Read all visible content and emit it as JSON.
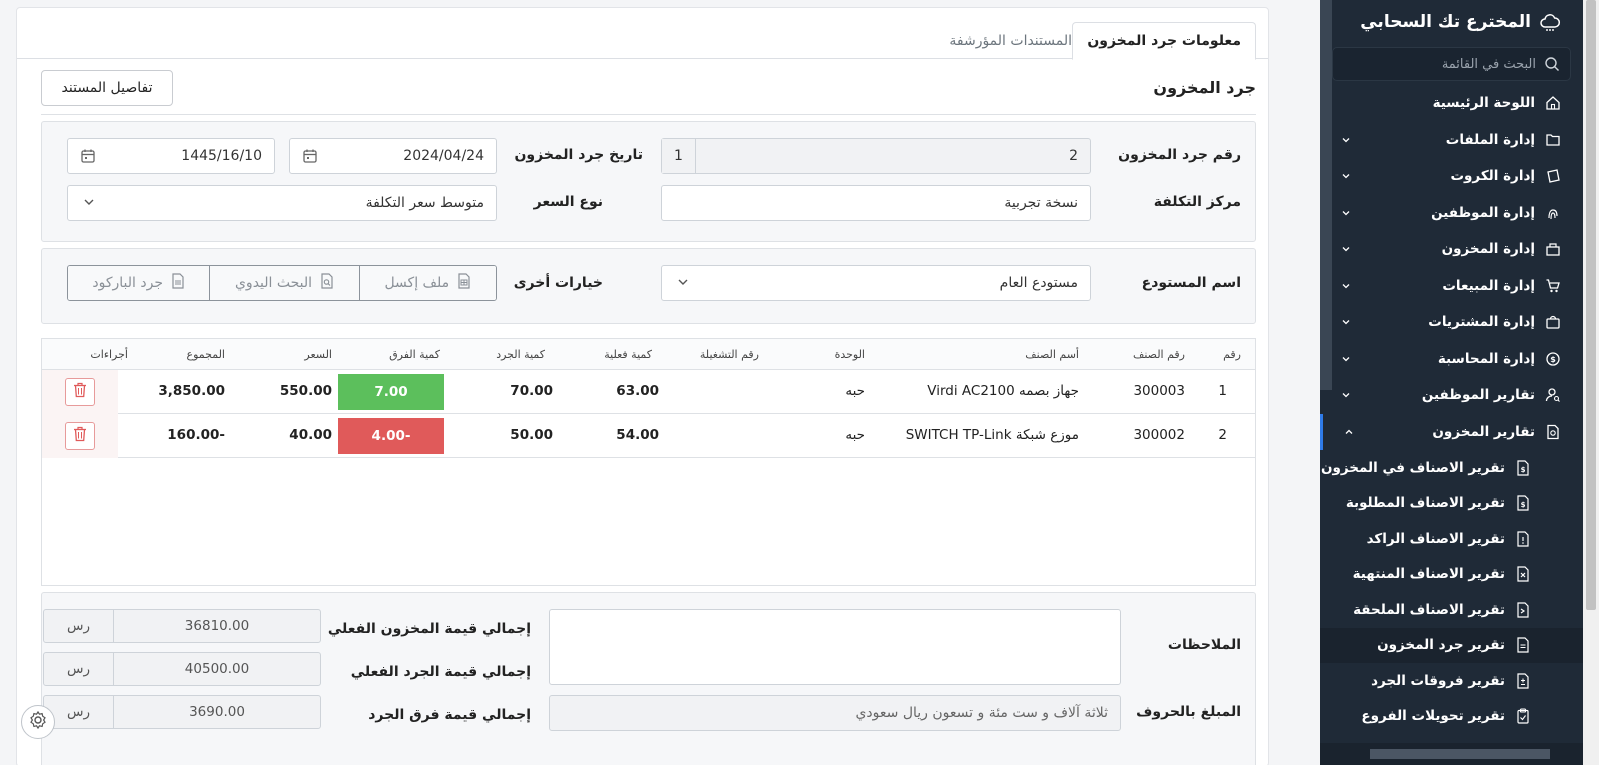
{
  "sidebar": {
    "brand": "المخترع تك السحابي",
    "search_placeholder": "البحث في القائمة",
    "items": [
      {
        "label": "اللوحة الرئيسية",
        "icon": "home-icon"
      },
      {
        "label": "إدارة الملفات",
        "icon": "folder-icon"
      },
      {
        "label": "إدارة الكروت",
        "icon": "card-icon"
      },
      {
        "label": "إدارة الموظفين",
        "icon": "fingerprint-icon"
      },
      {
        "label": "إدارة المخزون",
        "icon": "box-icon"
      },
      {
        "label": "إدارة المبيعات",
        "icon": "cart-icon"
      },
      {
        "label": "إدارة المشتريات",
        "icon": "bag-icon"
      },
      {
        "label": "إدارة المحاسبة",
        "icon": "coin-icon"
      },
      {
        "label": "تقارير الموظفين",
        "icon": "user-search-icon"
      },
      {
        "label": "تقارير المخزون",
        "icon": "report-icon"
      }
    ],
    "sub_items": [
      {
        "label": "تقرير الاصناف في المخزون"
      },
      {
        "label": "تقرير الاصناف المطلوبة"
      },
      {
        "label": "تقرير الاصناف الراكد"
      },
      {
        "label": "تقرير الاصناف المنتهية"
      },
      {
        "label": "تقرير الاصناف الملحقة"
      },
      {
        "label": "تقرير جرد المخزون"
      },
      {
        "label": "تقرير فروقات الجرد"
      },
      {
        "label": "تقرير تحويلات الفروع"
      }
    ]
  },
  "tabs": {
    "active": "معلومات جرد المخزون",
    "archived": "المستندات المؤرشفة"
  },
  "page_title": "جرد المخزون",
  "doc_details_button": "تفاصيل المستند",
  "form": {
    "inventory_number_label": "رقم جرد المخزون",
    "inventory_number": "2",
    "inventory_number_prefix": "1",
    "date_label": "تاريخ جرد المخزون",
    "date_gregorian": "2024/04/24",
    "date_hijri": "1445/16/10",
    "cost_center_label": "مركز التكلفة",
    "cost_center": "نسخة تجربية",
    "price_type_label": "نوع السعر",
    "price_type": "متوسط سعر التكلفة"
  },
  "warehouse": {
    "label": "اسم المستودع",
    "value": "مستودع العام",
    "other_options_label": "خيارات أخرى",
    "excel_button": "ملف إكسل",
    "manual_search_button": "البحث اليدوي",
    "barcode_button": "جرد الباركود"
  },
  "table": {
    "headers": {
      "num": "رقم",
      "item_code": "رقم الصنف",
      "item_name": "أسم الصنف",
      "unit": "الوحدة",
      "batch": "رقم التشغيلة",
      "actual_qty": "كمية فعلية",
      "count_qty": "كمية الجرد",
      "diff_qty": "كمية الفرق",
      "price": "السعر",
      "total": "المجموع",
      "actions": "أجراءات"
    },
    "rows": [
      {
        "num": "1",
        "item_code": "300003",
        "item_name": "جهاز بصمه Virdi AC2100",
        "unit": "حبه",
        "batch": "",
        "actual_qty": "63.00",
        "count_qty": "70.00",
        "diff_qty": "7.00",
        "price": "550.00",
        "total": "3,850.00",
        "diff_color": "#5cbf5c"
      },
      {
        "num": "2",
        "item_code": "300002",
        "item_name": "موزع شبكة SWITCH TP-Link",
        "unit": "حبه",
        "batch": "",
        "actual_qty": "54.00",
        "count_qty": "50.00",
        "diff_qty": "-4.00",
        "price": "40.00",
        "total": "-160.00",
        "diff_color": "#e05a5a"
      }
    ]
  },
  "summary": {
    "notes_label": "الملاحظات",
    "amount_words_label": "المبلغ بالحروف",
    "amount_words": "ثلاثة آلاف و ست مئة و تسعون ريال سعودي",
    "actual_stock_value_label": "إجمالي قيمة المخزون الفعلي",
    "actual_stock_value": "36810.00",
    "actual_count_value_label": "إجمالي قيمة الجرد الفعلي",
    "actual_count_value": "40500.00",
    "diff_value_label": "إجمالي قيمة فرق الجرد",
    "diff_value": "3690.00",
    "currency": "رس"
  }
}
